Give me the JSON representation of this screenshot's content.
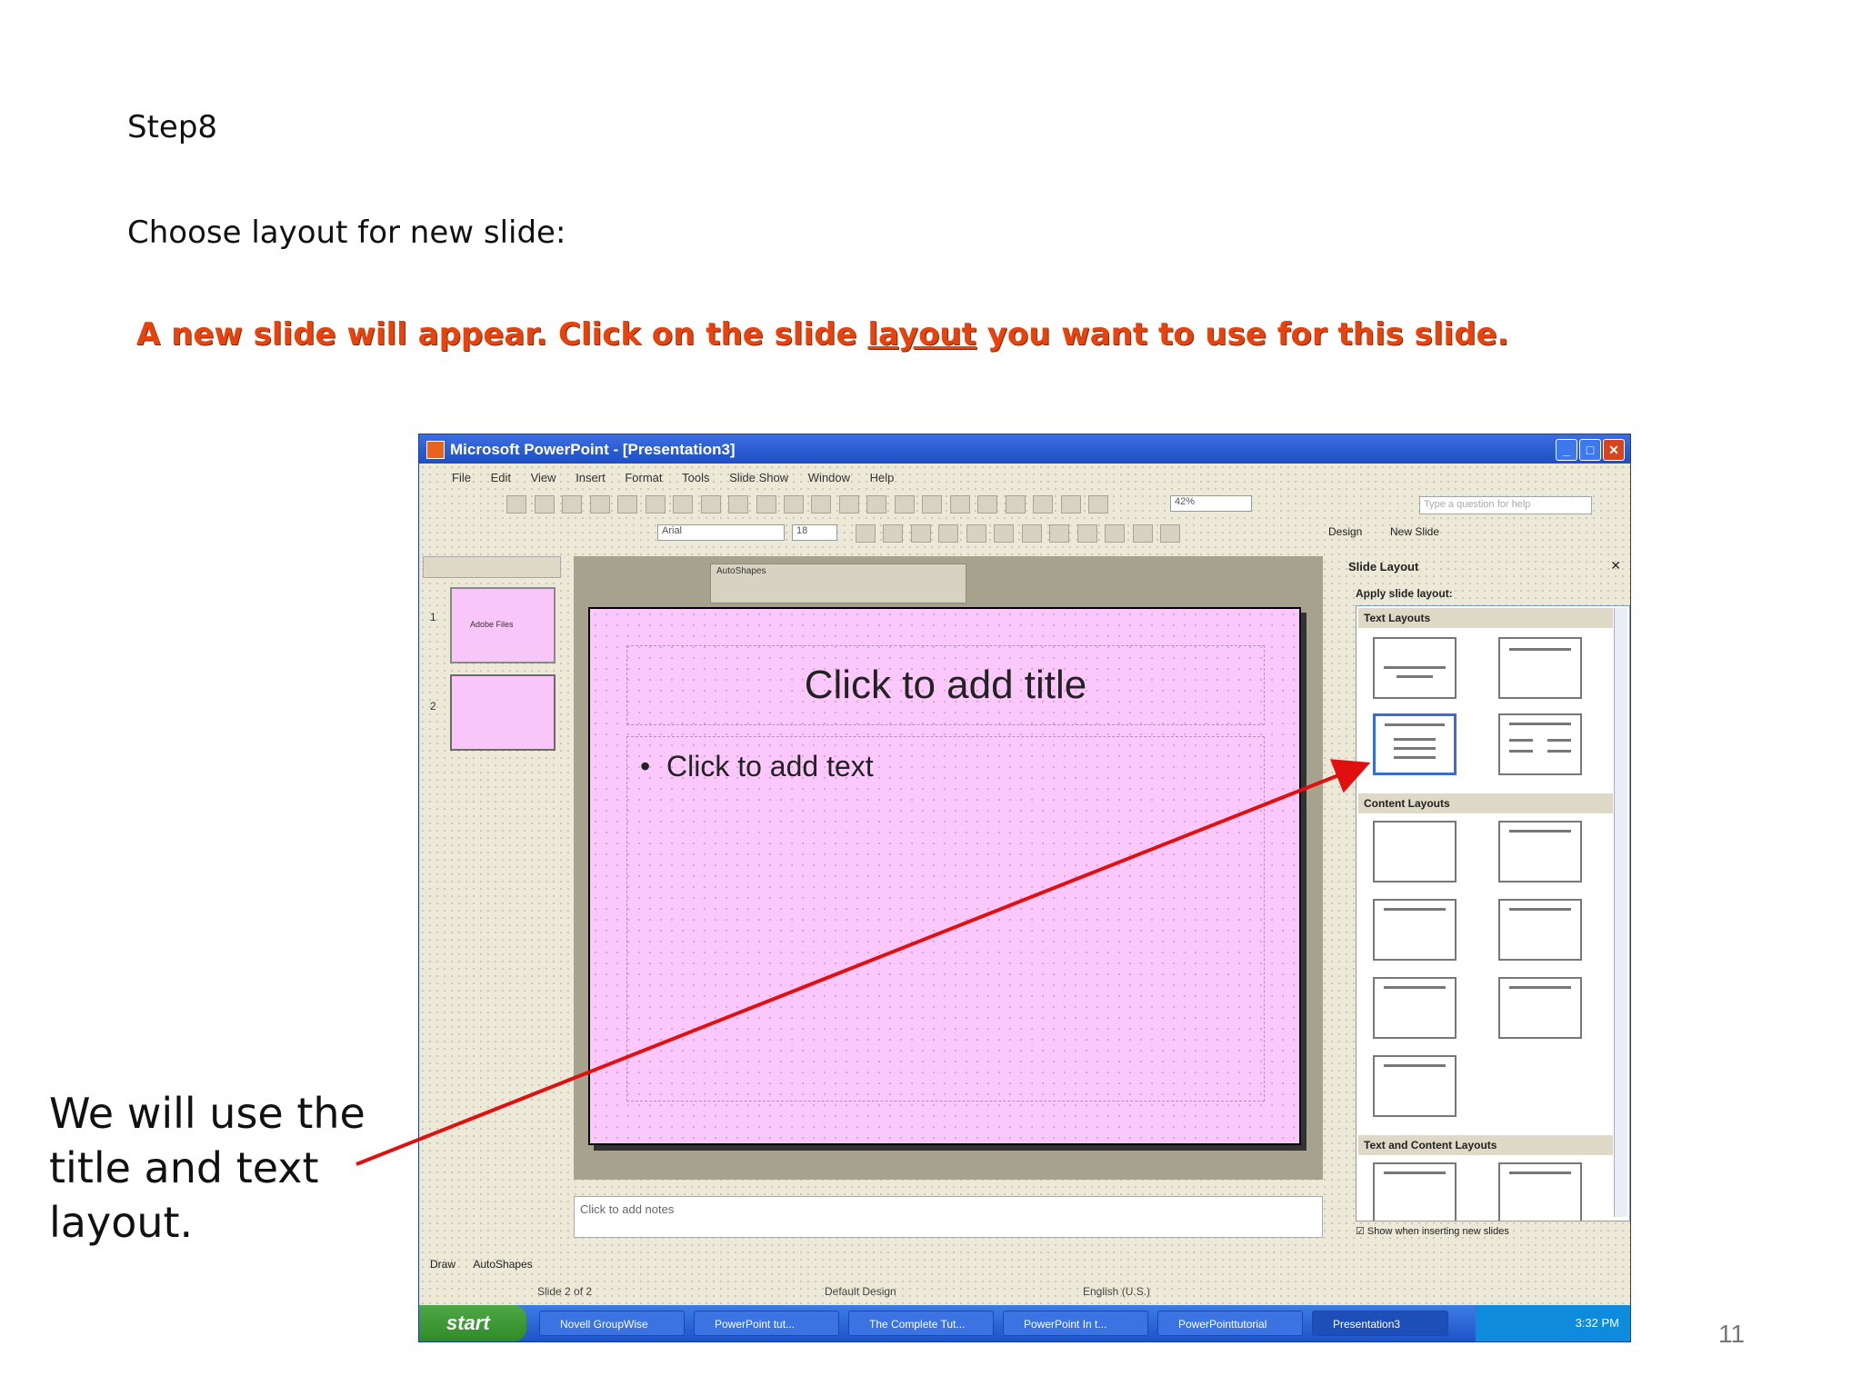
{
  "doc": {
    "step": "Step8",
    "instruction": "Choose layout for new slide:",
    "highlight_before": "A new slide will appear. Click on the slide ",
    "highlight_link": "layout",
    "highlight_after": " you want to use for this slide.",
    "callout": "We will use the title and text layout.",
    "page_number": "11"
  },
  "window": {
    "title": "Microsoft PowerPoint - [Presentation3]",
    "min": "_",
    "max": "□",
    "close": "✕",
    "help_placeholder": "Type a question for help"
  },
  "menu": [
    "File",
    "Edit",
    "View",
    "Insert",
    "Format",
    "Tools",
    "Slide Show",
    "Window",
    "Help"
  ],
  "toolbar": {
    "font": "Arial",
    "size": "18",
    "zoom": "42%",
    "design": "Design",
    "new_slide": "New Slide"
  },
  "outline": {
    "slides": [
      {
        "num": "1",
        "label": "Adobe Files"
      },
      {
        "num": "2",
        "label": ""
      }
    ]
  },
  "slide": {
    "title": "Click to add title",
    "bullet": "•",
    "body": "Click to add text",
    "floating_toolbar": "AutoShapes"
  },
  "notes": "Click to add notes",
  "taskpane": {
    "header": "Slide Layout",
    "apply": "Apply slide layout:",
    "sections": [
      "Text Layouts",
      "Content Layouts",
      "Text and Content Layouts"
    ],
    "show_when": "Show when inserting new slides"
  },
  "draw_toolbar": {
    "draw": "Draw",
    "autoshapes": "AutoShapes"
  },
  "status": {
    "slide": "Slide 2 of 2",
    "design": "Default Design",
    "lang": "English (U.S.)"
  },
  "taskbar": {
    "start": "start",
    "tasks": [
      "Novell GroupWise",
      "PowerPoint tut...",
      "The Complete Tut...",
      "PowerPoint In t...",
      "PowerPointtutorial",
      "Presentation3"
    ],
    "clock": "3:32 PM"
  },
  "colors": {
    "highlight": "#e8430d",
    "slide_bg": "#fbc8fb",
    "arrow": "#e01010",
    "selection": "#3a6cd6"
  }
}
